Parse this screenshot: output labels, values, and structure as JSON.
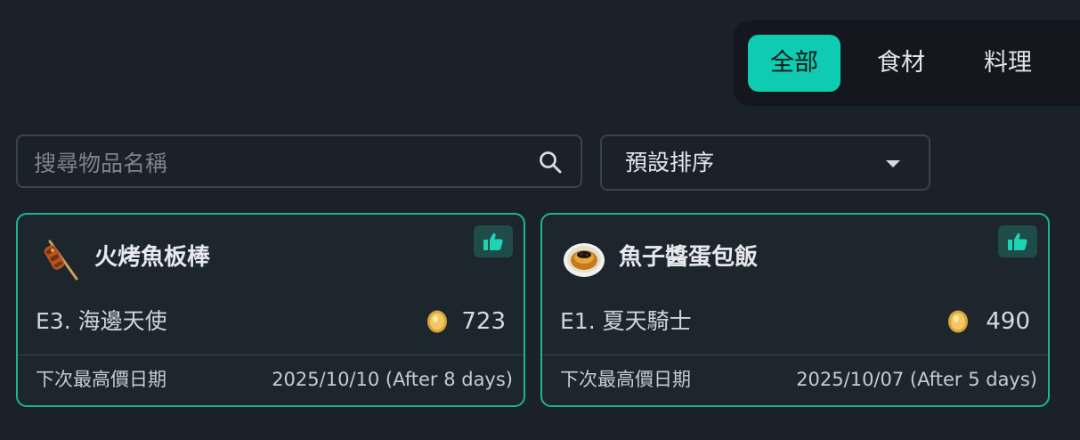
{
  "tabs": [
    {
      "label": "全部",
      "active": true
    },
    {
      "label": "食材",
      "active": false
    },
    {
      "label": "料理",
      "active": false
    }
  ],
  "search": {
    "placeholder": "搜尋物品名稱",
    "value": ""
  },
  "sort": {
    "selected": "預設排序"
  },
  "cards": [
    {
      "name": "火烤魚板棒",
      "icon": "grilled-fish-cake-skewer-icon",
      "source": "E3. 海邊天使",
      "price": "723",
      "footer_label": "下次最高價日期",
      "next_date": "2025/10/10 (After 8 days)"
    },
    {
      "name": "魚子醬蛋包飯",
      "icon": "caviar-omelet-rice-icon",
      "source": "E1. 夏天騎士",
      "price": "490",
      "footer_label": "下次最高價日期",
      "next_date": "2025/10/07 (After 5 days)"
    }
  ],
  "colors": {
    "accent": "#0ecbb1",
    "card_border": "#1fb394",
    "background": "#1b2129"
  }
}
